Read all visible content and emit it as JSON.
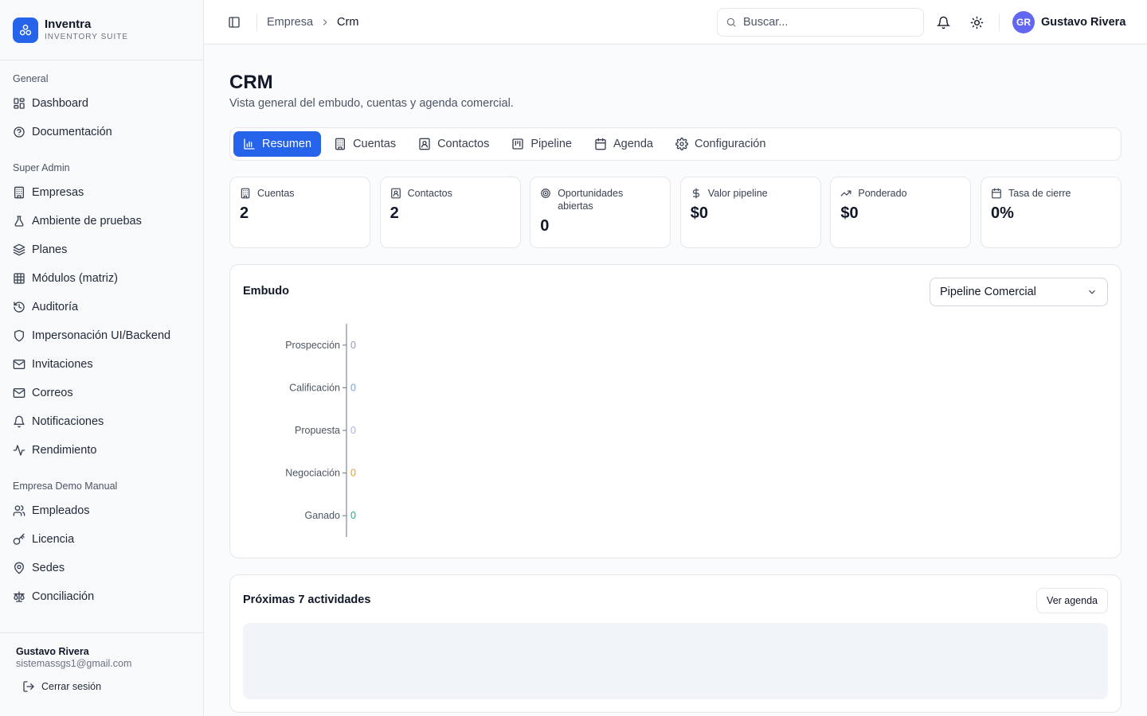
{
  "brand": {
    "name": "Inventra",
    "subtitle": "INVENTORY SUITE"
  },
  "sidebar": {
    "groups": [
      {
        "label": "General",
        "items": [
          {
            "label": "Dashboard",
            "icon": "dashboard-icon"
          },
          {
            "label": "Documentación",
            "icon": "help-circle-icon"
          }
        ]
      },
      {
        "label": "Super Admin",
        "items": [
          {
            "label": "Empresas",
            "icon": "building-icon"
          },
          {
            "label": "Ambiente de pruebas",
            "icon": "flask-icon"
          },
          {
            "label": "Planes",
            "icon": "layers-icon"
          },
          {
            "label": "Módulos (matriz)",
            "icon": "grid-table-icon"
          },
          {
            "label": "Auditoría",
            "icon": "history-icon"
          },
          {
            "label": "Impersonación UI/Backend",
            "icon": "shield-icon"
          },
          {
            "label": "Invitaciones",
            "icon": "mail-icon"
          },
          {
            "label": "Correos",
            "icon": "mail-icon"
          },
          {
            "label": "Notificaciones",
            "icon": "bell-icon"
          },
          {
            "label": "Rendimiento",
            "icon": "activity-icon"
          }
        ]
      },
      {
        "label": "Empresa Demo Manual",
        "items": [
          {
            "label": "Empleados",
            "icon": "users-icon"
          },
          {
            "label": "Licencia",
            "icon": "key-icon"
          },
          {
            "label": "Sedes",
            "icon": "map-pin-icon"
          },
          {
            "label": "Conciliación",
            "icon": "scale-icon"
          }
        ]
      }
    ],
    "footer": {
      "user_name": "Gustavo Rivera",
      "email": "sistemassgs1@gmail.com",
      "logout_label": "Cerrar sesión"
    }
  },
  "header": {
    "breadcrumb": [
      "Empresa",
      "Crm"
    ],
    "search_placeholder": "Buscar...",
    "avatar_initials": "GR",
    "user_name": "Gustavo Rivera"
  },
  "page": {
    "title": "CRM",
    "subtitle": "Vista general del embudo, cuentas y agenda comercial.",
    "tabs": [
      {
        "label": "Resumen",
        "active": true
      },
      {
        "label": "Cuentas"
      },
      {
        "label": "Contactos"
      },
      {
        "label": "Pipeline"
      },
      {
        "label": "Agenda"
      },
      {
        "label": "Configuración"
      }
    ],
    "stats": [
      {
        "label": "Cuentas",
        "value": "2",
        "icon": "building-icon"
      },
      {
        "label": "Contactos",
        "value": "2",
        "icon": "contact-icon"
      },
      {
        "label": "Oportunidades abiertas",
        "value": "0",
        "icon": "target-icon"
      },
      {
        "label": "Valor pipeline",
        "value": "$0",
        "icon": "dollar-icon"
      },
      {
        "label": "Ponderado",
        "value": "$0",
        "icon": "trending-up-icon"
      },
      {
        "label": "Tasa de cierre",
        "value": "0%",
        "icon": "calendar-icon"
      }
    ],
    "funnel": {
      "title": "Embudo",
      "select_value": "Pipeline Comercial"
    },
    "agenda": {
      "title": "Próximas 7 actividades",
      "button_label": "Ver agenda"
    }
  },
  "chart_data": {
    "type": "bar",
    "orientation": "horizontal",
    "categories": [
      "Prospección",
      "Calificación",
      "Propuesta",
      "Negociación",
      "Ganado"
    ],
    "values": [
      0,
      0,
      0,
      0,
      0
    ],
    "value_labels": [
      "0",
      "0",
      "0",
      "0",
      "0"
    ],
    "colors": [
      "#8b9dc3",
      "#60a5fa",
      "#a5b4fc",
      "#f59e0b",
      "#10b981"
    ],
    "title": "",
    "xlabel": "",
    "ylabel": "",
    "grid": false
  },
  "colors": {
    "accent": "#2563eb",
    "avatar": "#6366f1"
  }
}
